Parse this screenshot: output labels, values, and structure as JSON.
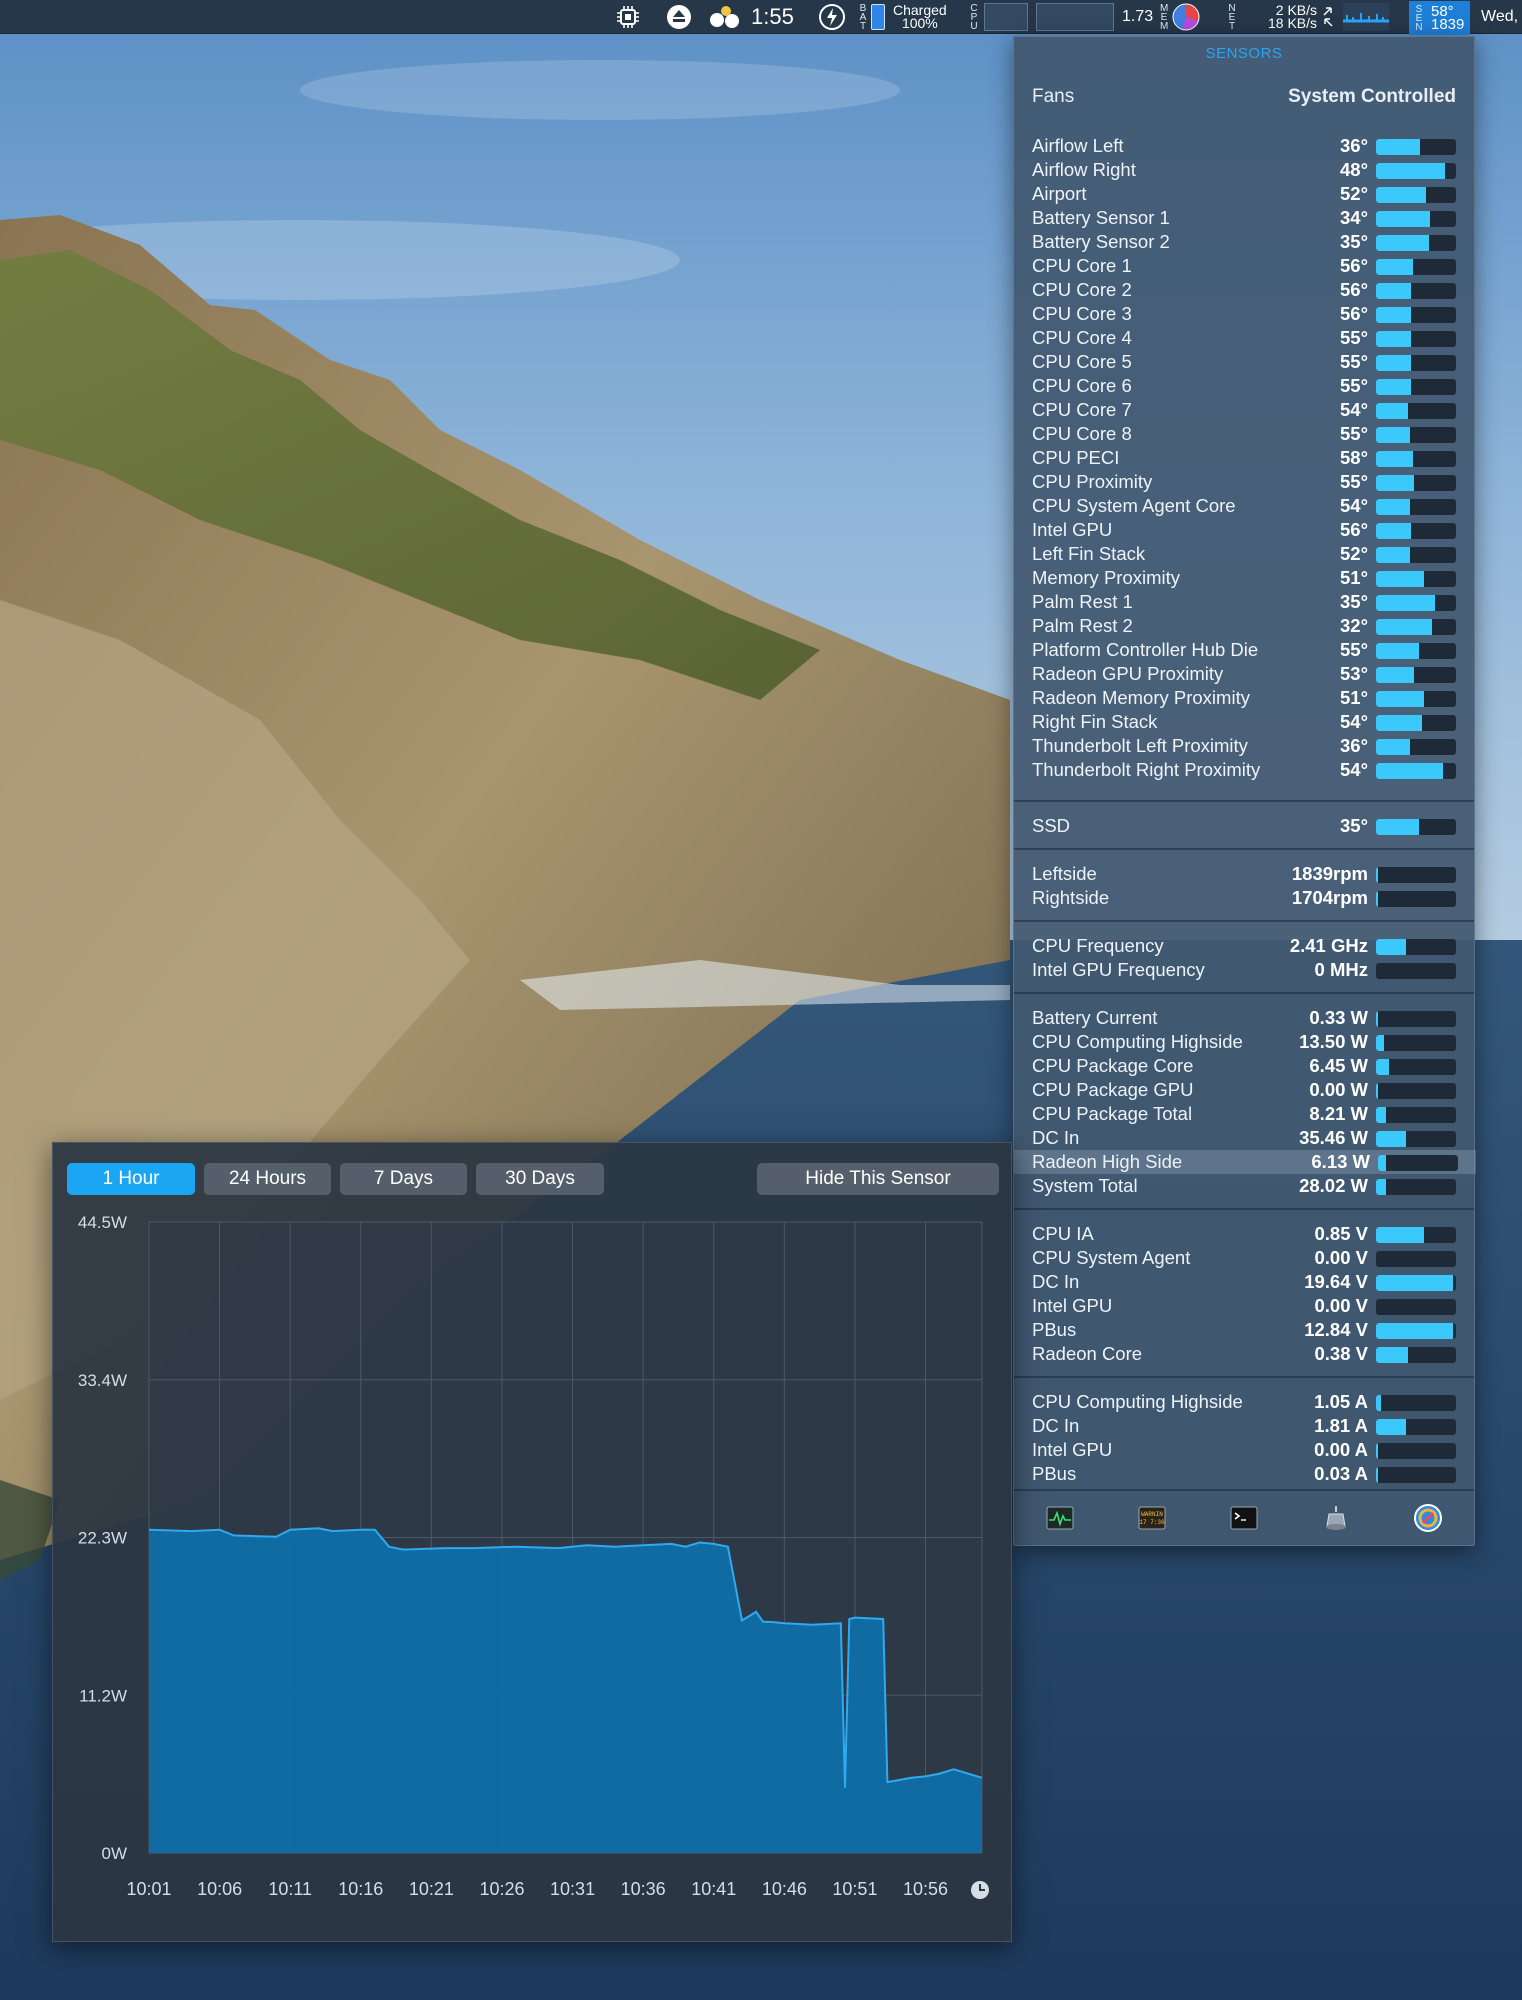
{
  "menubar": {
    "time": "1:55",
    "bat_label": "BAT",
    "bat_status": "Charged",
    "bat_percent": "100%",
    "cpu_label": "CPU",
    "load": "1.73",
    "mem_label": "MEM",
    "net_label": "NET",
    "net_up": "2 KB/s",
    "net_down": "18 KB/s",
    "sen_label": "SEN",
    "sen_temp": "58°",
    "sen_rpm": "1839",
    "date": "Wed,"
  },
  "sensors": {
    "title": "SENSORS",
    "fans_label": "Fans",
    "fans_value": "System Controlled",
    "temps": [
      {
        "name": "Airflow Left",
        "value": "36°",
        "level": 0.55
      },
      {
        "name": "Airflow Right",
        "value": "48°",
        "level": 0.86
      },
      {
        "name": "Airport",
        "value": "52°",
        "level": 0.62
      },
      {
        "name": "Battery Sensor 1",
        "value": "34°",
        "level": 0.68
      },
      {
        "name": "Battery Sensor 2",
        "value": "35°",
        "level": 0.66
      },
      {
        "name": "CPU Core 1",
        "value": "56°",
        "level": 0.46
      },
      {
        "name": "CPU Core 2",
        "value": "56°",
        "level": 0.44
      },
      {
        "name": "CPU Core 3",
        "value": "56°",
        "level": 0.44
      },
      {
        "name": "CPU Core 4",
        "value": "55°",
        "level": 0.44
      },
      {
        "name": "CPU Core 5",
        "value": "55°",
        "level": 0.44
      },
      {
        "name": "CPU Core 6",
        "value": "55°",
        "level": 0.44
      },
      {
        "name": "CPU Core 7",
        "value": "54°",
        "level": 0.4
      },
      {
        "name": "CPU Core 8",
        "value": "55°",
        "level": 0.42
      },
      {
        "name": "CPU PECI",
        "value": "58°",
        "level": 0.46
      },
      {
        "name": "CPU Proximity",
        "value": "55°",
        "level": 0.48
      },
      {
        "name": "CPU System Agent Core",
        "value": "54°",
        "level": 0.42
      },
      {
        "name": "Intel GPU",
        "value": "56°",
        "level": 0.44
      },
      {
        "name": "Left Fin Stack",
        "value": "52°",
        "level": 0.42
      },
      {
        "name": "Memory Proximity",
        "value": "51°",
        "level": 0.6
      },
      {
        "name": "Palm Rest 1",
        "value": "35°",
        "level": 0.74
      },
      {
        "name": "Palm Rest 2",
        "value": "32°",
        "level": 0.7
      },
      {
        "name": "Platform Controller Hub Die",
        "value": "55°",
        "level": 0.54
      },
      {
        "name": "Radeon GPU Proximity",
        "value": "53°",
        "level": 0.48
      },
      {
        "name": "Radeon Memory Proximity",
        "value": "51°",
        "level": 0.6
      },
      {
        "name": "Right Fin Stack",
        "value": "54°",
        "level": 0.58
      },
      {
        "name": "Thunderbolt Left Proximity",
        "value": "36°",
        "level": 0.42
      },
      {
        "name": "Thunderbolt Right Proximity",
        "value": "54°",
        "level": 0.84
      }
    ],
    "ssd": [
      {
        "name": "SSD",
        "value": "35°",
        "level": 0.54
      }
    ],
    "fans": [
      {
        "name": "Leftside",
        "value": "1839rpm",
        "level": 0.03
      },
      {
        "name": "Rightside",
        "value": "1704rpm",
        "level": 0.03
      }
    ],
    "frequency": [
      {
        "name": "CPU Frequency",
        "value": "2.41 GHz",
        "level": 0.38
      },
      {
        "name": "Intel GPU Frequency",
        "value": "0 MHz",
        "level": 0.0
      }
    ],
    "power": [
      {
        "name": "Battery Current",
        "value": "0.33 W",
        "level": 0.02
      },
      {
        "name": "CPU Computing Highside",
        "value": "13.50 W",
        "level": 0.1
      },
      {
        "name": "CPU Package Core",
        "value": "6.45 W",
        "level": 0.16
      },
      {
        "name": "CPU Package GPU",
        "value": "0.00 W",
        "level": 0.02
      },
      {
        "name": "CPU Package Total",
        "value": "8.21 W",
        "level": 0.12
      },
      {
        "name": "DC In",
        "value": "35.46 W",
        "level": 0.38
      },
      {
        "name": "Radeon High Side",
        "value": "6.13 W",
        "level": 0.1
      },
      {
        "name": "System Total",
        "value": "28.02 W",
        "level": 0.12
      }
    ],
    "voltage": [
      {
        "name": "CPU IA",
        "value": "0.85 V",
        "level": 0.6
      },
      {
        "name": "CPU System Agent",
        "value": "0.00 V",
        "level": 0.0
      },
      {
        "name": "DC In",
        "value": "19.64 V",
        "level": 0.96
      },
      {
        "name": "Intel GPU",
        "value": "0.00 V",
        "level": 0.0
      },
      {
        "name": "PBus",
        "value": "12.84 V",
        "level": 0.96
      },
      {
        "name": "Radeon Core",
        "value": "0.38 V",
        "level": 0.4
      }
    ],
    "current": [
      {
        "name": "CPU Computing Highside",
        "value": "1.05 A",
        "level": 0.06
      },
      {
        "name": "DC In",
        "value": "1.81 A",
        "level": 0.38
      },
      {
        "name": "Intel GPU",
        "value": "0.00 A",
        "level": 0.02
      },
      {
        "name": "PBus",
        "value": "0.03 A",
        "level": 0.02
      }
    ],
    "toolbar_icons": [
      "activity-monitor-icon",
      "console-icon",
      "terminal-icon",
      "disk-utility-icon",
      "istat-settings-icon"
    ],
    "console_icon_text": "WARNIN 17 7:36"
  },
  "history": {
    "ranges": [
      "1 Hour",
      "24 Hours",
      "7 Days",
      "30 Days"
    ],
    "active_range": "1 Hour",
    "hide_button": "Hide This Sensor"
  },
  "chart_data": {
    "type": "area",
    "series": [
      {
        "name": "Radeon High Side",
        "color": "#0e6ea6"
      }
    ],
    "y_ticks": [
      "44.5W",
      "33.4W",
      "22.3W",
      "11.2W",
      "0W"
    ],
    "ylim": [
      0,
      44.5
    ],
    "x_ticks": [
      "10:01",
      "10:06",
      "10:11",
      "10:16",
      "10:21",
      "10:26",
      "10:31",
      "10:36",
      "10:41",
      "10:46",
      "10:51",
      "10:56"
    ],
    "x": [
      "10:01",
      "10:04",
      "10:06",
      "10:07",
      "10:10",
      "10:11",
      "10:13",
      "10:14",
      "10:16",
      "10:17",
      "10:18",
      "10:19",
      "10:22",
      "10:24",
      "10:27",
      "10:30",
      "10:32",
      "10:34",
      "10:36",
      "10:38",
      "10:39",
      "10:40",
      "10:41",
      "10:42",
      "10:43",
      "10:44",
      "10:44.5",
      "10:45",
      "10:46",
      "10:48",
      "10:50",
      "10:50.3",
      "10:50.6",
      "10:51",
      "10:53",
      "10:53.3",
      "10:55",
      "10:56",
      "10:57",
      "10:58",
      "11:00"
    ],
    "values": [
      22.8,
      22.7,
      22.8,
      22.4,
      22.3,
      22.8,
      22.9,
      22.7,
      22.8,
      22.8,
      21.6,
      21.4,
      21.5,
      21.5,
      21.6,
      21.5,
      21.7,
      21.6,
      21.7,
      21.8,
      21.6,
      21.9,
      21.8,
      21.6,
      16.4,
      17.0,
      16.3,
      16.3,
      16.2,
      16.1,
      16.2,
      4.6,
      16.5,
      16.6,
      16.5,
      5.0,
      5.3,
      5.4,
      5.6,
      5.9,
      5.3
    ],
    "colors": {
      "fill": "#0e6ea6",
      "line": "#2fa9f0",
      "grid": "#4b5868",
      "accent": "#1ba6f4",
      "bar_fill": "#3bc8fa"
    }
  }
}
